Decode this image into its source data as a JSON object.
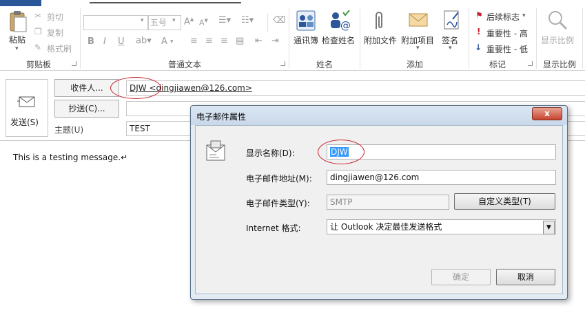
{
  "ribbon": {
    "clipboard": {
      "paste": "粘贴",
      "cut": "剪切",
      "copy": "复制",
      "format_painter": "格式刷",
      "label": "剪贴板"
    },
    "basic_text": {
      "font_size": "五号",
      "bold": "B",
      "italic": "I",
      "underline": "U",
      "font_color": "A",
      "label": "普通文本"
    },
    "names": {
      "address_book": "通讯簿",
      "check_names": "检查姓名",
      "label": "姓名"
    },
    "include": {
      "attach_file": "附加文件",
      "attach_item": "附加项目",
      "signature": "签名",
      "label": "添加"
    },
    "tags": {
      "follow_up": "后续标志",
      "high_importance": "重要性 - 高",
      "low_importance": "重要性 - 低",
      "label": "标记"
    },
    "zoom": {
      "zoom": "显示比例",
      "label": "显示比例"
    }
  },
  "form": {
    "send_label": "发送(S)",
    "to_button": "收件人...",
    "cc_button": "抄送(C)...",
    "subject_label": "主题(U)",
    "to_value": "DJW <dingjiawen@126.com>",
    "cc_value": "",
    "subject_value": "TEST",
    "body_text": "This is a testing message.↵"
  },
  "dialog": {
    "title": "电子邮件属性",
    "close_glyph": "x",
    "display_name_label": "显示名称(D):",
    "display_name_value": "DJW",
    "email_address_label": "电子邮件地址(M):",
    "email_address_value": "dingjiawen@126.com",
    "email_type_label": "电子邮件类型(Y):",
    "email_type_value": "SMTP",
    "custom_type_button": "自定义类型(T)",
    "internet_format_label": "Internet 格式:",
    "internet_format_value": "让 Outlook 决定最佳发送格式",
    "ok_button": "确定",
    "cancel_button": "取消"
  },
  "colors": {
    "accent": "#2b579a",
    "annotation": "#c8202c",
    "selection": "#3399ff"
  }
}
